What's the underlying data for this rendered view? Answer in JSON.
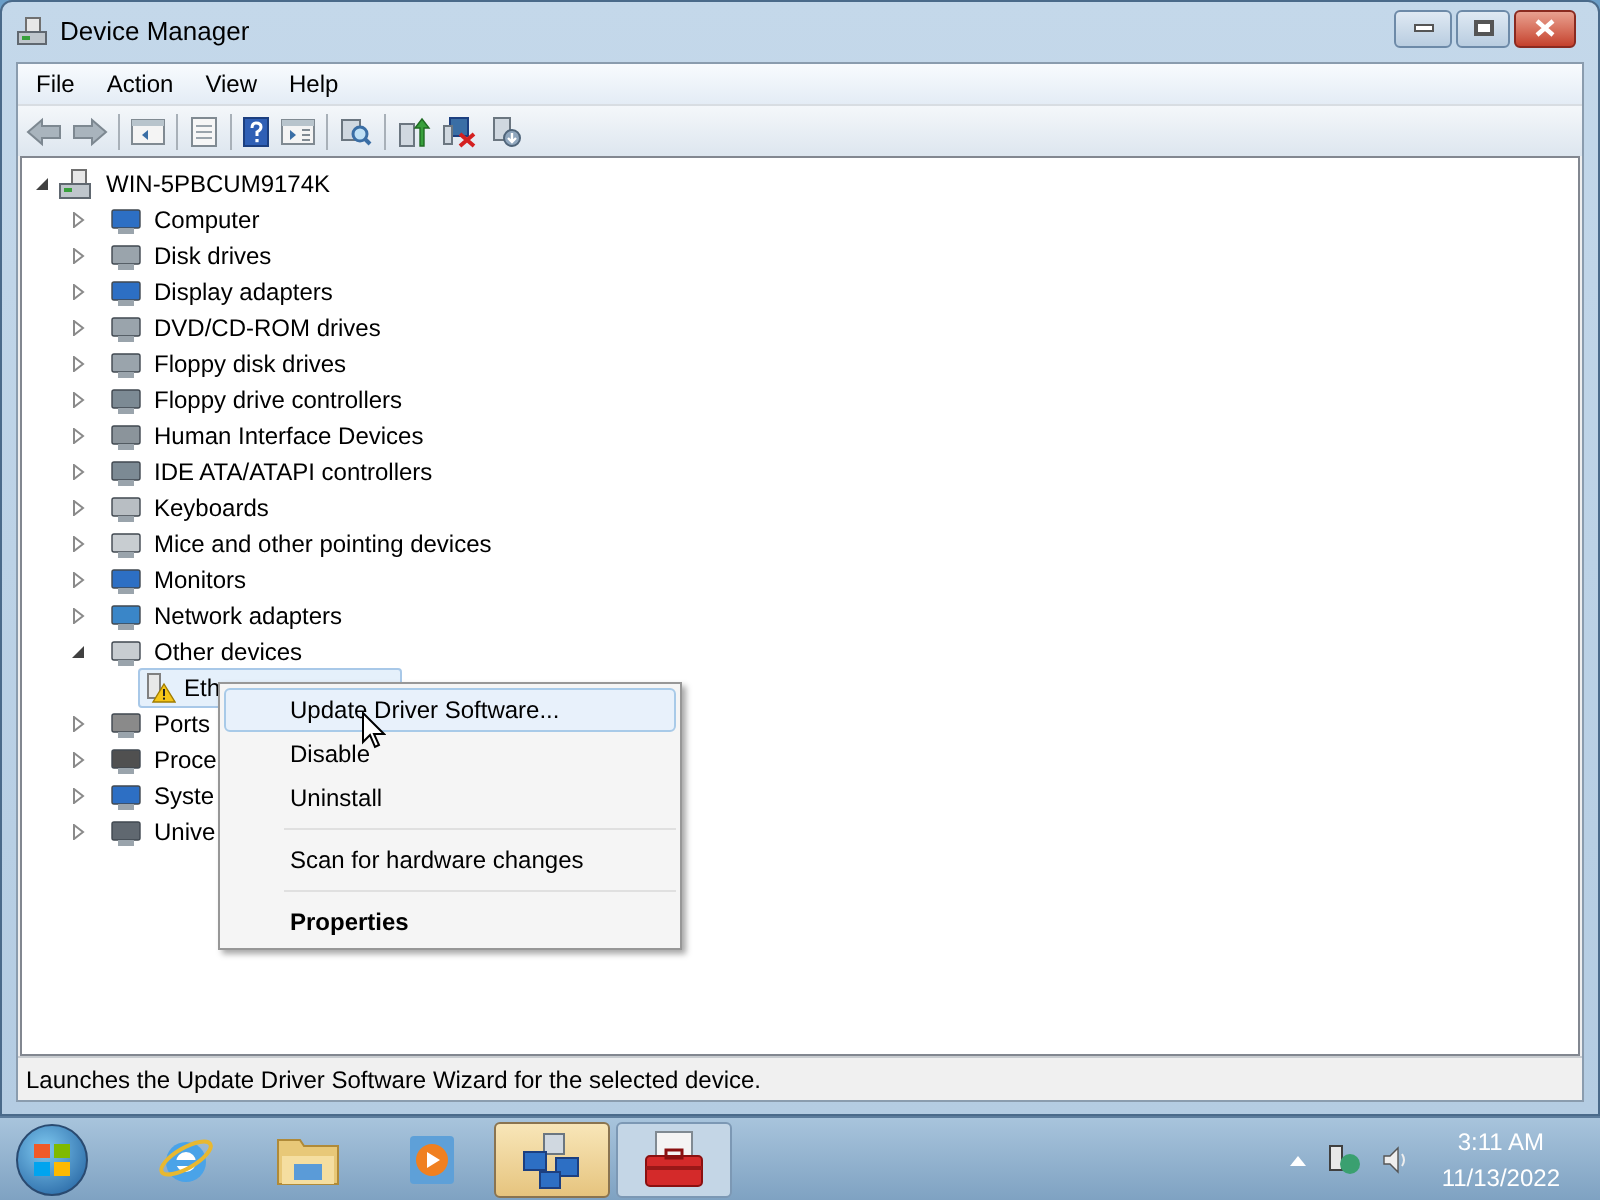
{
  "window": {
    "title": "Device Manager"
  },
  "menu_bar": [
    {
      "label": "File"
    },
    {
      "label": "Action"
    },
    {
      "label": "View"
    },
    {
      "label": "Help"
    }
  ],
  "toolbar": [
    {
      "kind": "back"
    },
    {
      "kind": "forward"
    },
    {
      "kind": "separator"
    },
    {
      "kind": "tree"
    },
    {
      "kind": "separator"
    },
    {
      "kind": "properties"
    },
    {
      "kind": "separator"
    },
    {
      "kind": "help"
    },
    {
      "kind": "pane"
    },
    {
      "kind": "separator"
    },
    {
      "kind": "scan"
    },
    {
      "kind": "separator"
    },
    {
      "kind": "update"
    },
    {
      "kind": "uninstall"
    },
    {
      "kind": "disable"
    }
  ],
  "tree": {
    "label": "WIN-5PBCUM9174K",
    "expanded": true,
    "children": [
      {
        "label": "Computer",
        "expanded": false
      },
      {
        "label": "Disk drives",
        "expanded": false
      },
      {
        "label": "Display adapters",
        "expanded": false
      },
      {
        "label": "DVD/CD-ROM drives",
        "expanded": false
      },
      {
        "label": "Floppy disk drives",
        "expanded": false
      },
      {
        "label": "Floppy drive controllers",
        "expanded": false
      },
      {
        "label": "Human Interface Devices",
        "expanded": false
      },
      {
        "label": "IDE ATA/ATAPI controllers",
        "expanded": false
      },
      {
        "label": "Keyboards",
        "expanded": false
      },
      {
        "label": "Mice and other pointing devices",
        "expanded": false
      },
      {
        "label": "Monitors",
        "expanded": false
      },
      {
        "label": "Network adapters",
        "expanded": false
      },
      {
        "label": "Other devices",
        "expanded": true,
        "children": [
          {
            "label": "Eth",
            "selected": true,
            "warning": true
          }
        ]
      },
      {
        "label": "Ports",
        "expanded": false
      },
      {
        "label": "Proce",
        "expanded": false
      },
      {
        "label": "Syste",
        "expanded": false
      },
      {
        "label": "Unive",
        "expanded": false
      }
    ]
  },
  "context_menu": [
    {
      "kind": "item",
      "label": "Update Driver Software...",
      "selected": true,
      "default": false
    },
    {
      "kind": "item",
      "label": "Disable",
      "selected": false,
      "default": false
    },
    {
      "kind": "item",
      "label": "Uninstall",
      "selected": false,
      "default": false
    },
    {
      "kind": "separator"
    },
    {
      "kind": "item",
      "label": "Scan for hardware changes",
      "selected": false,
      "default": false
    },
    {
      "kind": "separator"
    },
    {
      "kind": "item",
      "label": "Properties",
      "selected": false,
      "default": true
    }
  ],
  "status_bar": "Launches the Update Driver Software Wizard for the selected device.",
  "taskbar": {
    "apps": [
      {
        "kind": "browser",
        "selected": false
      },
      {
        "kind": "folder",
        "selected": false
      },
      {
        "kind": "media",
        "selected": false
      },
      {
        "kind": "network",
        "selected": true
      },
      {
        "kind": "toolbox",
        "selected": false
      }
    ],
    "time": "3:11 AM",
    "date": "11/13/2022"
  }
}
